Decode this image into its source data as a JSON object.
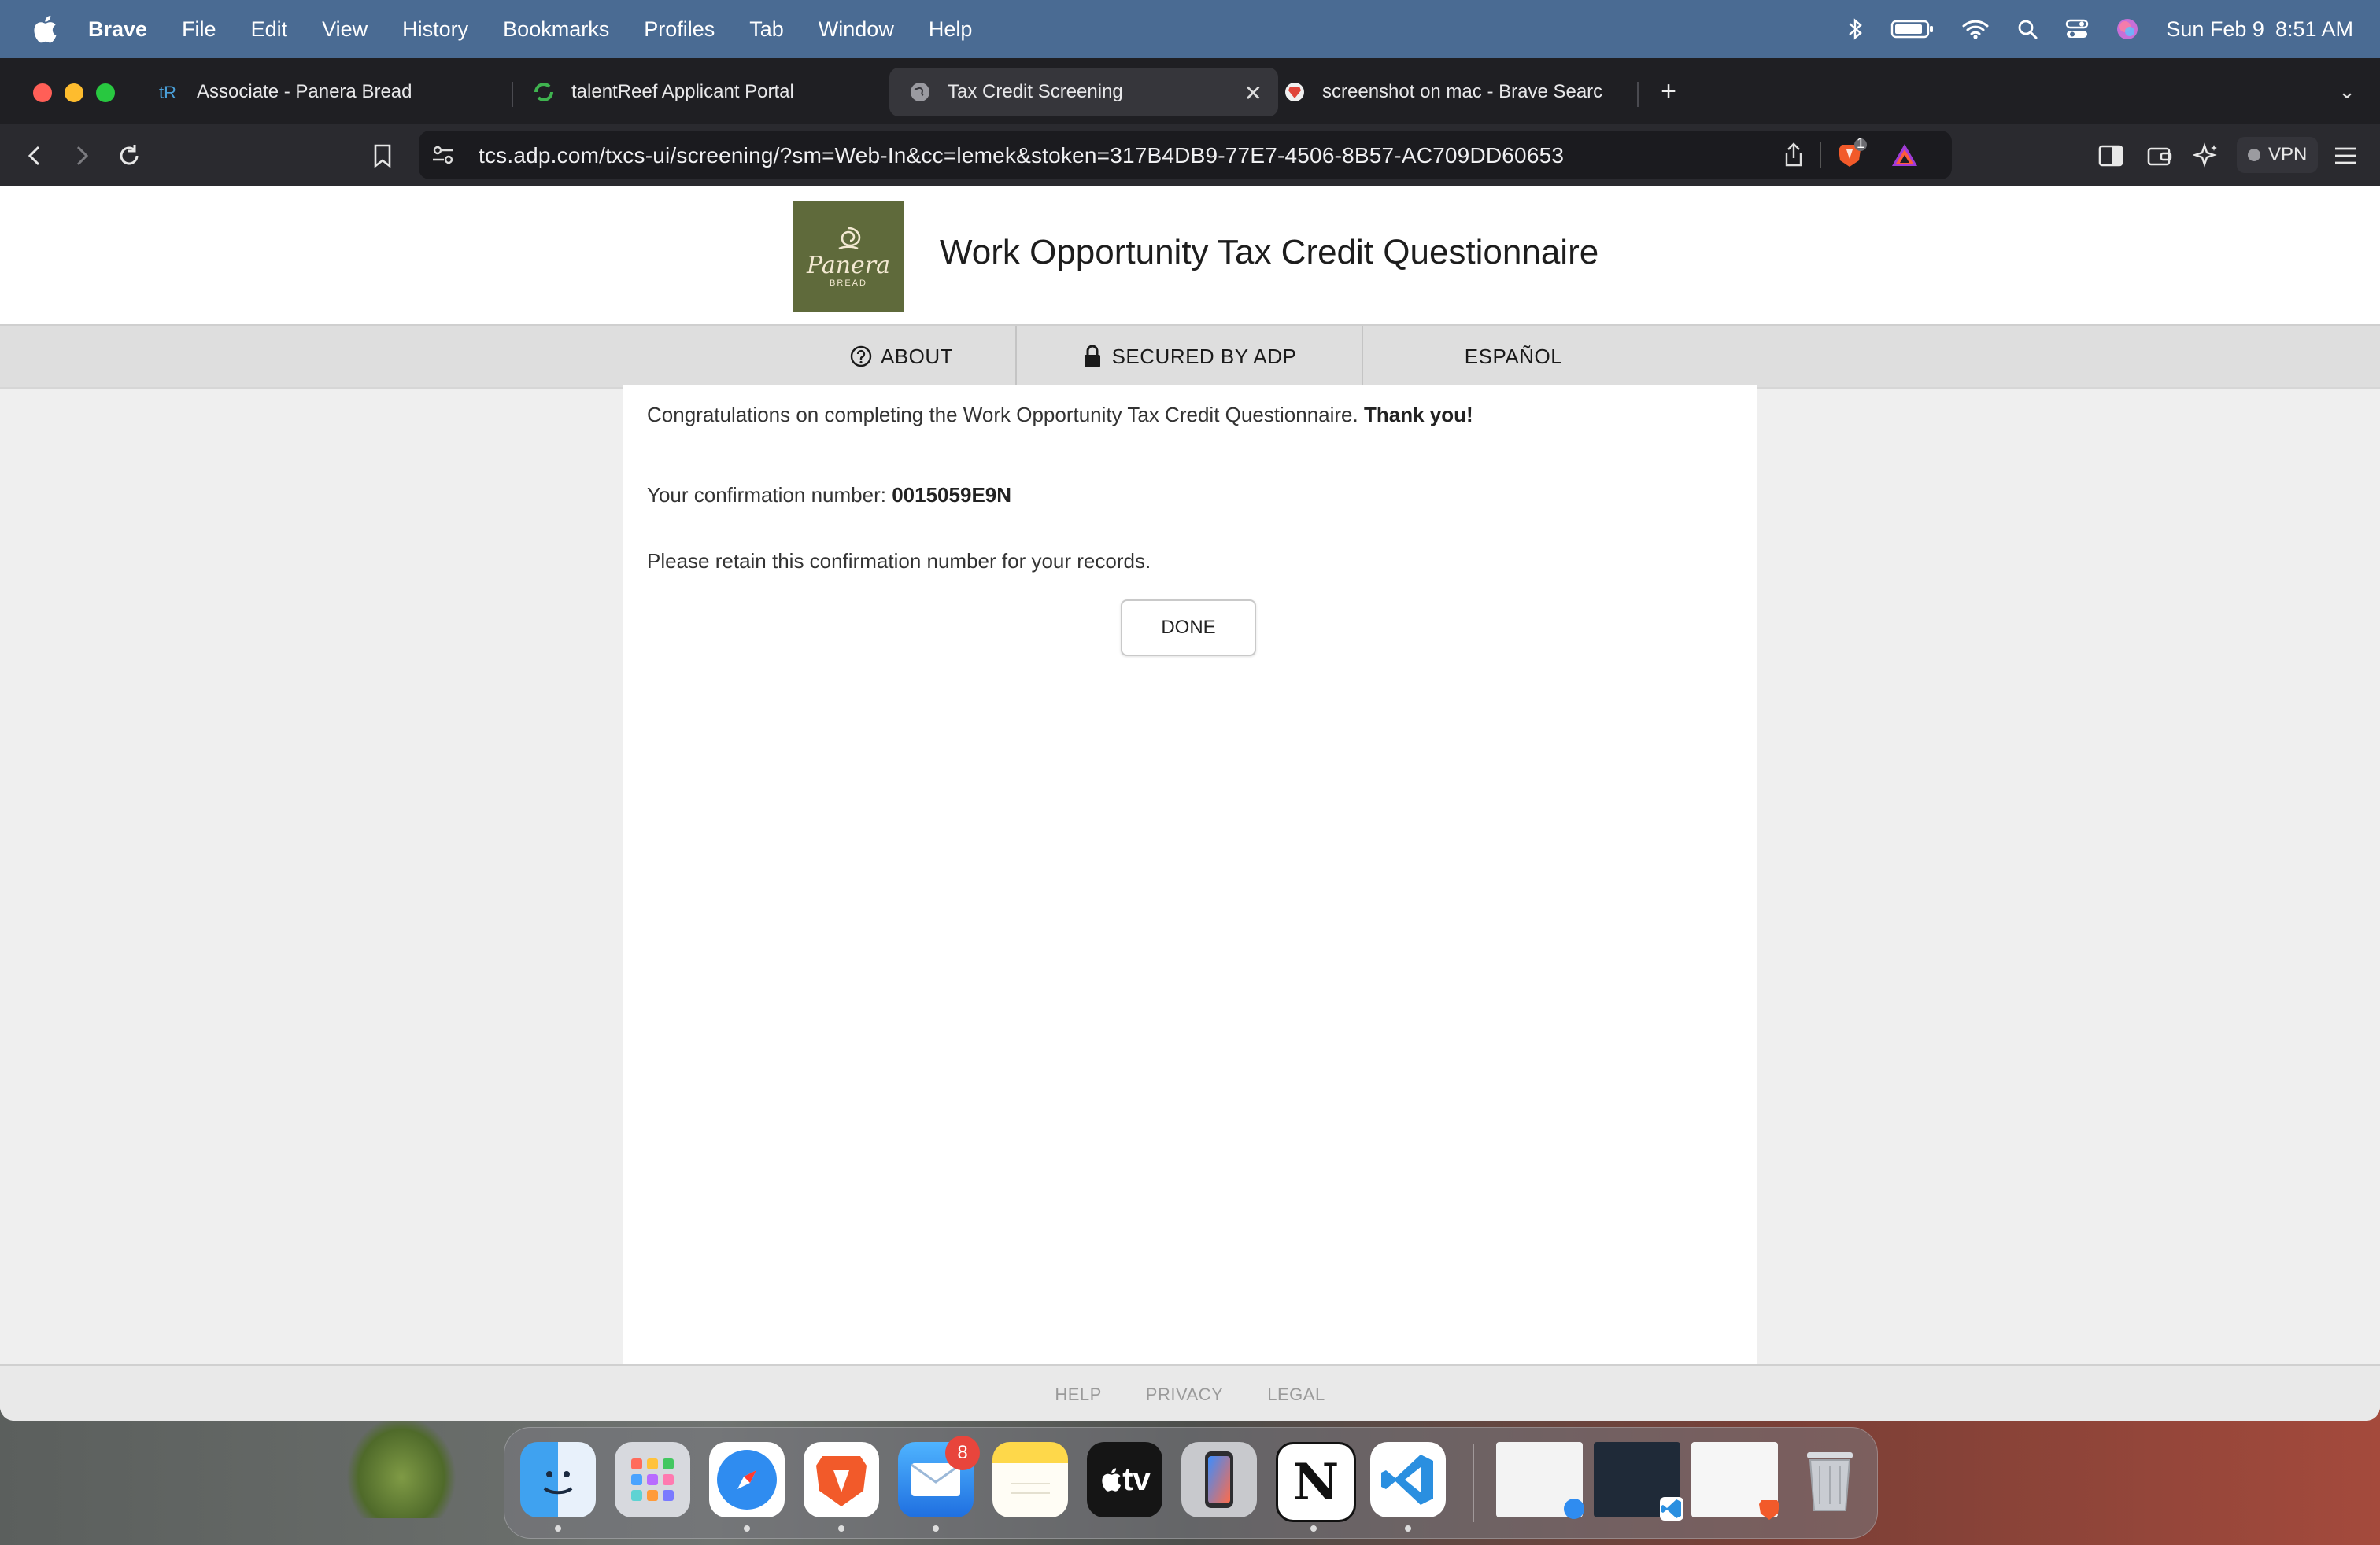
{
  "menubar": {
    "app_name": "Brave",
    "items": [
      "File",
      "Edit",
      "View",
      "History",
      "Bookmarks",
      "Profiles",
      "Tab",
      "Window",
      "Help"
    ],
    "date": "Sun Feb 9",
    "time": "8:51 AM"
  },
  "browser": {
    "tabs": [
      {
        "title": "Associate - Panera Bread"
      },
      {
        "title": "talentReef Applicant Portal"
      },
      {
        "title": "Tax Credit Screening"
      },
      {
        "title": "screenshot on mac - Brave Searc"
      }
    ],
    "url": "tcs.adp.com/txcs-ui/screening/?sm=Web-In&cc=lemek&stoken=317B4DB9-77E7-4506-8B57-AC709DD60653",
    "shields_count": "1",
    "vpn_label": "VPN"
  },
  "page": {
    "logo": {
      "word": "Panera",
      "small": "BREAD"
    },
    "title": "Work Opportunity Tax Credit Questionnaire",
    "nav": {
      "about": "ABOUT",
      "secured": "SECURED BY ADP",
      "espanol": "ESPAÑOL"
    },
    "congrats_text": "Congratulations on completing the Work Opportunity Tax Credit Questionnaire.",
    "thank_you": "Thank you!",
    "confirmation_label": "Your confirmation number:",
    "confirmation_number": "0015059E9N",
    "retain_text": "Please retain this confirmation number for your records.",
    "done_label": "DONE",
    "footer": {
      "help": "HELP",
      "privacy": "PRIVACY",
      "legal": "LEGAL"
    }
  },
  "dock": {
    "apps": [
      "finder",
      "launchpad",
      "safari",
      "brave",
      "mail",
      "notes",
      "apple-tv",
      "iphone-mirroring",
      "notion",
      "vscode"
    ],
    "mail_badge": "8",
    "tv_label": "tv"
  }
}
